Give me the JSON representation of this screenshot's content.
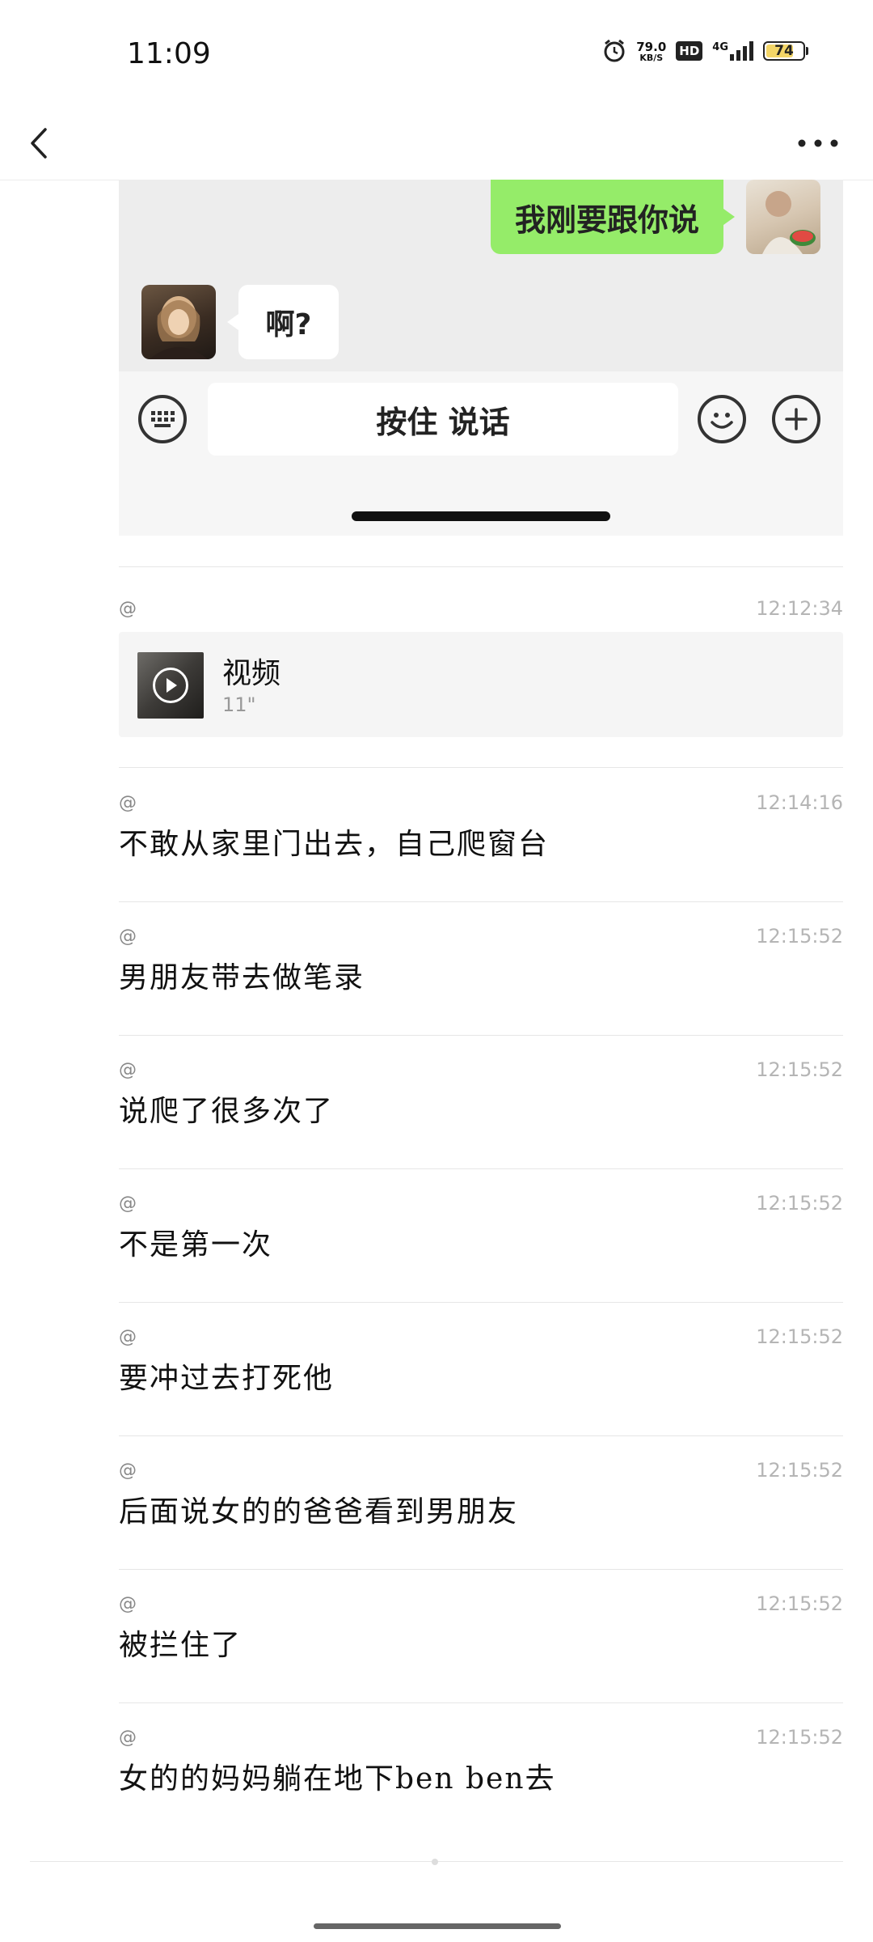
{
  "status_bar": {
    "time": "11:09",
    "net_speed_value": "79.0",
    "net_speed_unit": "KB/S",
    "hd": "HD",
    "signal_label": "4G",
    "battery": "74"
  },
  "embedded_chat": {
    "right_message": "我刚要跟你说",
    "left_message": "啊?",
    "hold_to_talk": "按住 说话"
  },
  "video_entry": {
    "at": "@",
    "timestamp": "12:12:34",
    "label": "视频",
    "duration": "11\""
  },
  "messages": [
    {
      "at": "@",
      "timestamp": "12:14:16",
      "text": "不敢从家里门出去，自己爬窗台"
    },
    {
      "at": "@",
      "timestamp": "12:15:52",
      "text": "男朋友带去做笔录"
    },
    {
      "at": "@",
      "timestamp": "12:15:52",
      "text": "说爬了很多次了"
    },
    {
      "at": "@",
      "timestamp": "12:15:52",
      "text": "不是第一次"
    },
    {
      "at": "@",
      "timestamp": "12:15:52",
      "text": "要冲过去打死他"
    },
    {
      "at": "@",
      "timestamp": "12:15:52",
      "text": "后面说女的的爸爸看到男朋友"
    },
    {
      "at": "@",
      "timestamp": "12:15:52",
      "text": "被拦住了"
    },
    {
      "at": "@",
      "timestamp": "12:15:52",
      "text": "女的的妈妈躺在地下ben ben去"
    }
  ],
  "colors": {
    "bubble_green": "#95ec69",
    "timestamp_gray": "#b5b5b5",
    "battery_fill": "#f3d567"
  }
}
